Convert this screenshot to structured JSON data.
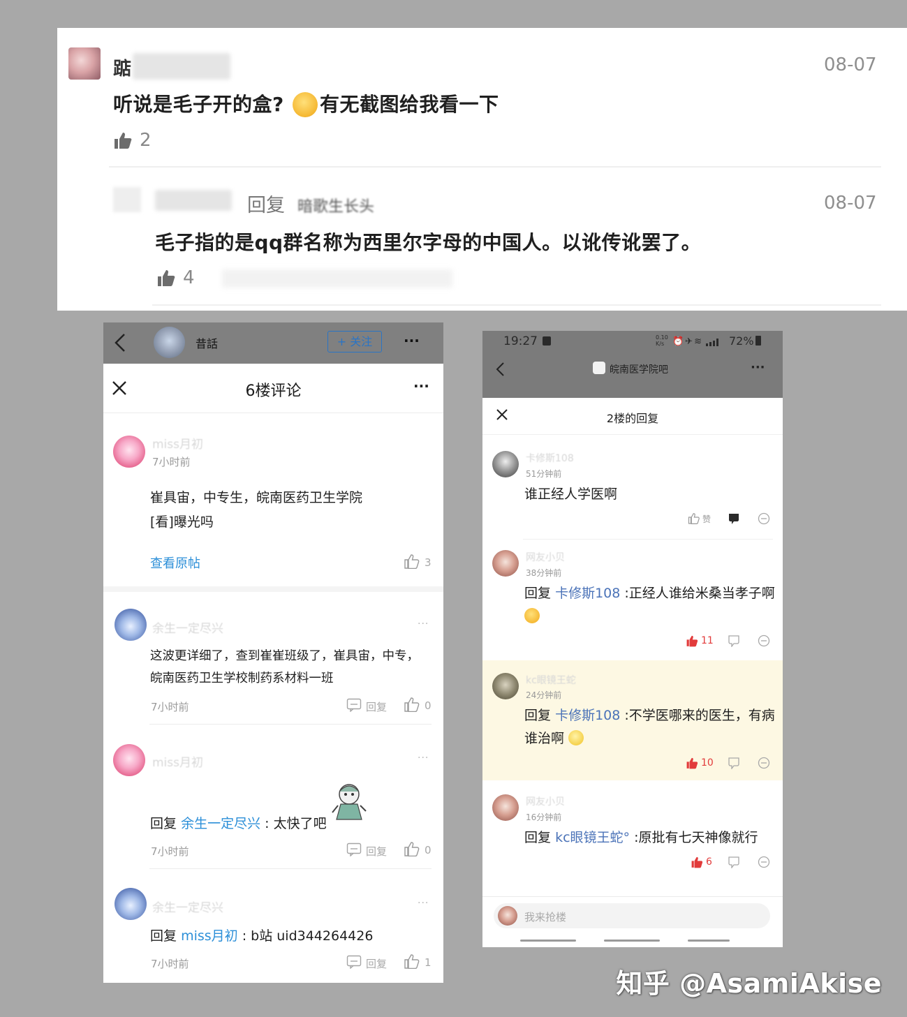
{
  "panel1": {
    "top_comment": {
      "user_initial": "踮",
      "date": "08-07",
      "text": "听说是毛子开的盒?",
      "text_after_emoji": "有无截图给我看一下",
      "likes": "2"
    },
    "reply": {
      "reply_word": "回复",
      "target_partial": "暗歌生长头",
      "date": "08-07",
      "text": "毛子指的是qq群名称为西里尔字母的中国人。以讹传讹罢了。",
      "likes": "4"
    }
  },
  "panel2": {
    "topbar": {
      "user_name": "昔話",
      "follow_label": "+ 关注",
      "more": "···"
    },
    "header": {
      "title": "6楼评论",
      "more": "···"
    },
    "main_post": {
      "user_ghost": "miss月初",
      "time": "7小时前",
      "text_line1": "崔具宙，中专生，皖南医药卫生学院",
      "text_line2": "[看]曝光吗",
      "view_original": "查看原帖",
      "likes": "3"
    },
    "comments": [
      {
        "user_ghost": "余生一定尽兴",
        "text": "这波更详细了，查到崔崔班级了，崔具宙，中专，皖南医药卫生学校制药系材料一班",
        "time": "7小时前",
        "reply_label": "回复",
        "likes": "0"
      },
      {
        "user_ghost": "miss月初",
        "reply_prefix": "回复",
        "reply_target": "余生一定尽兴",
        "reply_text": ": 太快了吧",
        "time": "7小时前",
        "reply_label": "回复",
        "likes": "0"
      },
      {
        "user_ghost": "余生一定尽兴",
        "reply_prefix": "回复",
        "reply_target": "miss月初",
        "reply_text": ": b站 uid344264426",
        "time": "7小时前",
        "reply_label": "回复",
        "likes": "1"
      }
    ]
  },
  "panel3": {
    "status": {
      "time": "19:27",
      "speed": "0.10 K/s",
      "battery": "72%"
    },
    "forum_name": "皖南医学院吧",
    "sheet_title": "2楼的回复",
    "replies": [
      {
        "user_ghost": "卡修斯108",
        "time": "51分钟前",
        "text": "谁正经人学医啊",
        "like_label": "赞"
      },
      {
        "user_ghost": "网友小贝",
        "time": "38分钟前",
        "prefix": "回复",
        "target": "卡修斯108",
        "text": ":正经人谁给米桑当孝子啊",
        "likes": "11"
      },
      {
        "user_ghost": "kc眼镜王蛇",
        "time": "24分钟前",
        "prefix": "回复",
        "target": "卡修斯108",
        "text": ":不学医哪来的医生，有病谁治啊",
        "likes": "10"
      },
      {
        "user_ghost": "网友小贝",
        "time": "16分钟前",
        "prefix": "回复",
        "target": "kc眼镜王蛇°",
        "text": ":原批有七天神像就行",
        "likes": "6"
      }
    ],
    "input_placeholder": "我来抢楼"
  },
  "watermark": "知乎 @AsamiAkise",
  "colors": {
    "link_blue": "#2c8fd8",
    "link_navy": "#4b73b8",
    "like_red": "#e23b3b",
    "highlight": "#fdf8e3"
  }
}
